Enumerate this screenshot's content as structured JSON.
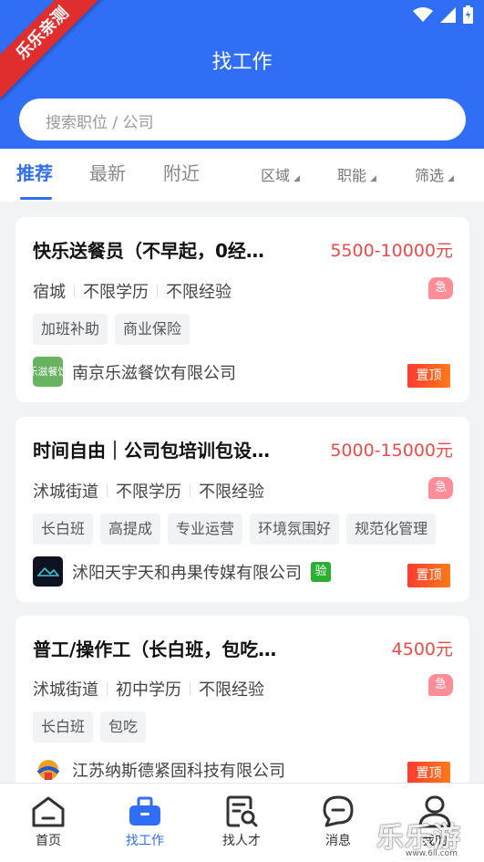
{
  "watermark": {
    "corner": "乐乐亲测",
    "bottom": "乐乐游戏",
    "url": "www.6ll.com"
  },
  "header": {
    "title": "找工作",
    "search_placeholder": "搜索职位 / 公司"
  },
  "tabs": [
    {
      "label": "推荐",
      "active": true
    },
    {
      "label": "最新",
      "active": false
    },
    {
      "label": "附近",
      "active": false
    }
  ],
  "filters": [
    {
      "label": "区域"
    },
    {
      "label": "职能"
    },
    {
      "label": "筛选"
    }
  ],
  "jobs": [
    {
      "title": "快乐送餐员（不早起，0经…",
      "salary": "5500-10000元",
      "location": "宿城",
      "education": "不限学历",
      "experience": "不限经验",
      "urgent_label": "急",
      "tags": [
        "加班补助",
        "商业保险"
      ],
      "company": "南京乐滋餐饮有限公司",
      "logo_text": "乐滋餐饮",
      "verified_label": "",
      "pin_label": "置顶"
    },
    {
      "title": "时间自由｜公司包培训包设…",
      "salary": "5000-15000元",
      "location": "沭城街道",
      "education": "不限学历",
      "experience": "不限经验",
      "urgent_label": "急",
      "tags": [
        "长白班",
        "高提成",
        "专业运营",
        "环境氛围好",
        "规范化管理"
      ],
      "company": "沭阳天宇天和冉果传媒有限公司",
      "verified_label": "验",
      "pin_label": "置顶"
    },
    {
      "title": "普工/操作工（长白班，包吃…",
      "salary": "4500元",
      "location": "沭城街道",
      "education": "初中学历",
      "experience": "不限经验",
      "urgent_label": "急",
      "tags": [
        "长白班",
        "包吃"
      ],
      "company": "江苏纳斯德紧固科技有限公司",
      "verified_label": "",
      "pin_label": "置顶"
    }
  ],
  "bottom_nav": [
    {
      "label": "首页",
      "icon": "home-icon",
      "active": false
    },
    {
      "label": "找工作",
      "icon": "briefcase-icon",
      "active": true
    },
    {
      "label": "找人才",
      "icon": "resume-search-icon",
      "active": false
    },
    {
      "label": "消息",
      "icon": "message-icon",
      "active": false
    },
    {
      "label": "我的",
      "icon": "user-icon",
      "active": false
    }
  ],
  "colors": {
    "primary": "#2f6ef5",
    "salary": "#ef4a4a",
    "urgent": "#ff8d97",
    "pin": "#ff4a22",
    "verified": "#2bb12f"
  }
}
